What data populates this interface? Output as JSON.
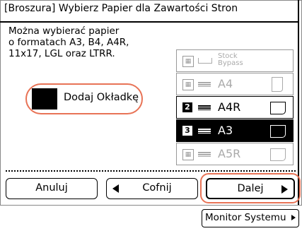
{
  "title": "[Broszura] Wybierz Papier dla Zawartości Stron",
  "description": "Można wybierać papier\no formatach A3, B4, A4R,\n11x17, LGL oraz LTRR.",
  "cover": {
    "label": "Dodaj Okładkę"
  },
  "trays": [
    {
      "num": "",
      "size": "Stock\nBypass",
      "state": "disabled",
      "orient": "portrait"
    },
    {
      "num": "",
      "size": "A4",
      "state": "disabled",
      "orient": "portrait"
    },
    {
      "num": "2",
      "size": "A4R",
      "state": "normal",
      "orient": "landscape"
    },
    {
      "num": "3",
      "size": "A3",
      "state": "selected",
      "orient": "landscape"
    },
    {
      "num": "",
      "size": "A5R",
      "state": "disabled",
      "orient": "landscape"
    }
  ],
  "buttons": {
    "cancel": "Anuluj",
    "back": "Cofnij",
    "next": "Dalej",
    "monitor": "Monitor Systemu"
  },
  "accent_color": "#e87356"
}
